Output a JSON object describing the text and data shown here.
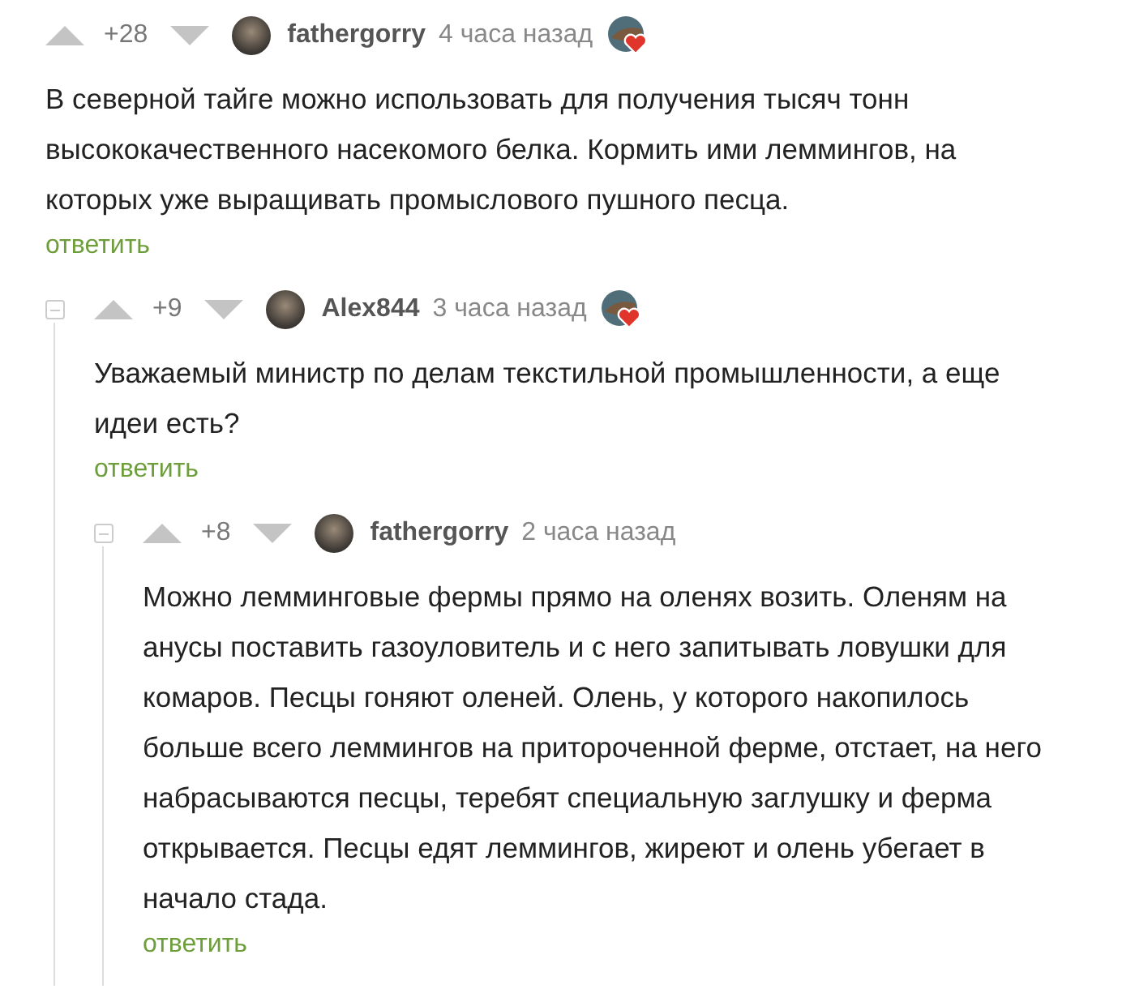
{
  "comments": [
    {
      "rating": "+28",
      "author": "fathergorry",
      "time": "4 часа назад",
      "badge": true,
      "text": "В северной тайге можно использовать для получения тысяч тонн высококачественного насекомого белка. Кормить ими леммингов, на которых уже выращивать промыслового пушного песца.",
      "reply": "ответить",
      "children": [
        {
          "rating": "+9",
          "author": "Alex844",
          "time": "3 часа назад",
          "badge": true,
          "text": "Уважаемый министр по делам текстильной промышленности, а еще идеи есть?",
          "reply": "ответить",
          "children": [
            {
              "rating": "+8",
              "author": "fathergorry",
              "time": "2 часа назад",
              "badge": false,
              "text": "Можно лемминговые фермы прямо на оленях возить. Оленям на анусы поставить газоуловитель и с него запитывать ловушки для комаров. Песцы гоняют оленей. Олень, у которого накопилось больше всего леммингов на притороченной ферме, отстает, на него набрасываются песцы, теребят специальную заглушку и ферма открывается. Песцы едят леммингов, жиреют и олень убегает в начало стада.",
              "reply": "ответить"
            }
          ]
        }
      ]
    }
  ]
}
